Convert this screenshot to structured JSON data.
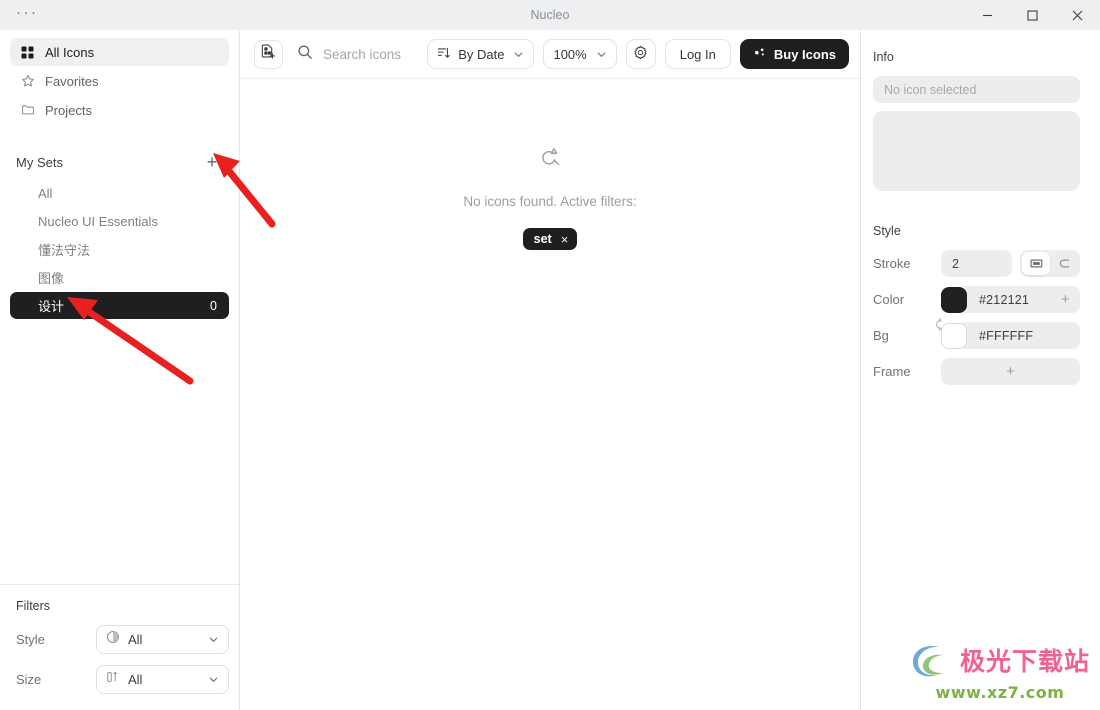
{
  "window": {
    "title": "Nucleo",
    "menu_dots": "···",
    "minimize_label": "Minimize",
    "maximize_label": "Maximize",
    "close_label": "Close"
  },
  "sidebar": {
    "nav": [
      {
        "label": "All Icons",
        "icon": "grid-icon",
        "active": true
      },
      {
        "label": "Favorites",
        "icon": "star-icon",
        "active": false
      },
      {
        "label": "Projects",
        "icon": "folder-icon",
        "active": false
      }
    ],
    "sets": {
      "title": "My Sets",
      "add_label": "+",
      "items": [
        {
          "label": "All",
          "count": "",
          "active": false
        },
        {
          "label": "Nucleo UI Essentials",
          "count": "",
          "active": false
        },
        {
          "label": "懂法守法",
          "count": "",
          "active": false
        },
        {
          "label": "图像",
          "count": "",
          "active": false
        },
        {
          "label": "设计",
          "count": "0",
          "active": true
        }
      ]
    },
    "filters": {
      "title": "Filters",
      "rows": [
        {
          "label": "Style",
          "value": "All",
          "icon": "style-circle-icon"
        },
        {
          "label": "Size",
          "value": "All",
          "icon": "size-icon"
        }
      ]
    }
  },
  "toolbar": {
    "import_icon": "add-file-icon",
    "search": {
      "placeholder": "Search icons",
      "value": "",
      "icon": "search-icon"
    },
    "sort": {
      "label": "By Date",
      "icon": "sort-icon",
      "chevron": "chevron-down-icon"
    },
    "zoom": {
      "label": "100%",
      "chevron": "chevron-down-icon"
    },
    "settings": {
      "label": "Settings",
      "icon": "gear-icon"
    },
    "login": {
      "label": "Log In"
    },
    "buy": {
      "label": "Buy Icons",
      "icon": "sparkle-icon"
    }
  },
  "canvas": {
    "empty_icon": "search-no-result-icon",
    "empty_text": "No icons found. Active filters:",
    "chips": [
      {
        "label": "set",
        "remove": "×"
      }
    ]
  },
  "right_panel": {
    "info": {
      "title": "Info",
      "placeholder": "No icon selected",
      "preview_empty": ""
    },
    "style": {
      "title": "Style",
      "stroke": {
        "label": "Stroke",
        "value": "2"
      },
      "cap_toggle": [
        {
          "name": "stroke-cap-square",
          "active": true
        },
        {
          "name": "stroke-cap-round",
          "active": false
        }
      ],
      "color": {
        "label": "Color",
        "value": "#212121",
        "add": "+"
      },
      "bg": {
        "label": "Bg",
        "value": "#FFFFFF"
      },
      "swap_icon": "swap-colors-icon",
      "frame": {
        "label": "Frame",
        "add": "+"
      }
    }
  },
  "annotations": {
    "arrow_color": "#e8201f",
    "arrows": [
      {
        "name": "arrow-to-add-set-button",
        "points": "to +"
      },
      {
        "name": "arrow-to-selected-set",
        "points": "to 设计"
      }
    ]
  },
  "watermark": {
    "text": "极光下载站",
    "url": "www.xz7.com",
    "text_color": "#f06292",
    "url_color": "#7cb342"
  }
}
